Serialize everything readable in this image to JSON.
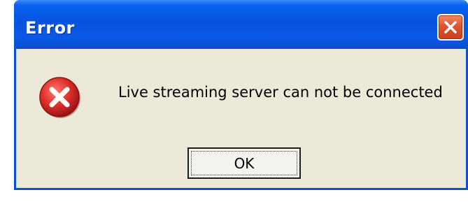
{
  "window": {
    "title": "Error",
    "close_icon": "close-icon",
    "titlebar_color": "#0654e0",
    "close_button_color": "#e0532e"
  },
  "dialog": {
    "icon": "error-icon",
    "icon_color": "#d8252a",
    "message": "Live streaming server can not be connected",
    "background_color": "#ece9d8"
  },
  "buttons": {
    "ok_label": "OK"
  }
}
